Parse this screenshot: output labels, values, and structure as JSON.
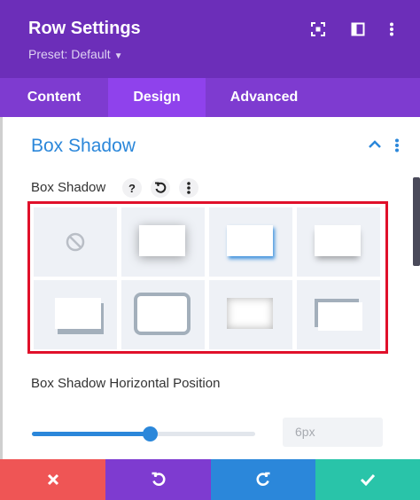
{
  "header": {
    "title": "Row Settings",
    "preset_label": "Preset: Default",
    "background": "#6c2eb9",
    "icons": [
      "focus-icon",
      "split-view-icon",
      "more-icon"
    ]
  },
  "tabs": [
    {
      "label": "Content",
      "active": false
    },
    {
      "label": "Design",
      "active": true
    },
    {
      "label": "Advanced",
      "active": false
    }
  ],
  "section": {
    "title": "Box Shadow",
    "accent_color": "#2b87da"
  },
  "box_shadow": {
    "label": "Box Shadow",
    "help_glyph": "?",
    "options": [
      "none",
      "soft-all-around",
      "bottom-accent",
      "bottom-soft",
      "bottom-left-solid",
      "outline-all-around",
      "inset-all-around",
      "top-left-solid"
    ],
    "selection_border_color": "#e0102a"
  },
  "horizontal_position": {
    "label": "Box Shadow Horizontal Position",
    "value": "6px",
    "slider_fraction": 0.53
  },
  "footer": {
    "colors": {
      "cancel": "#ef5555",
      "undo": "#7e3bd0",
      "redo": "#2b87da",
      "save": "#29c4a9"
    }
  }
}
